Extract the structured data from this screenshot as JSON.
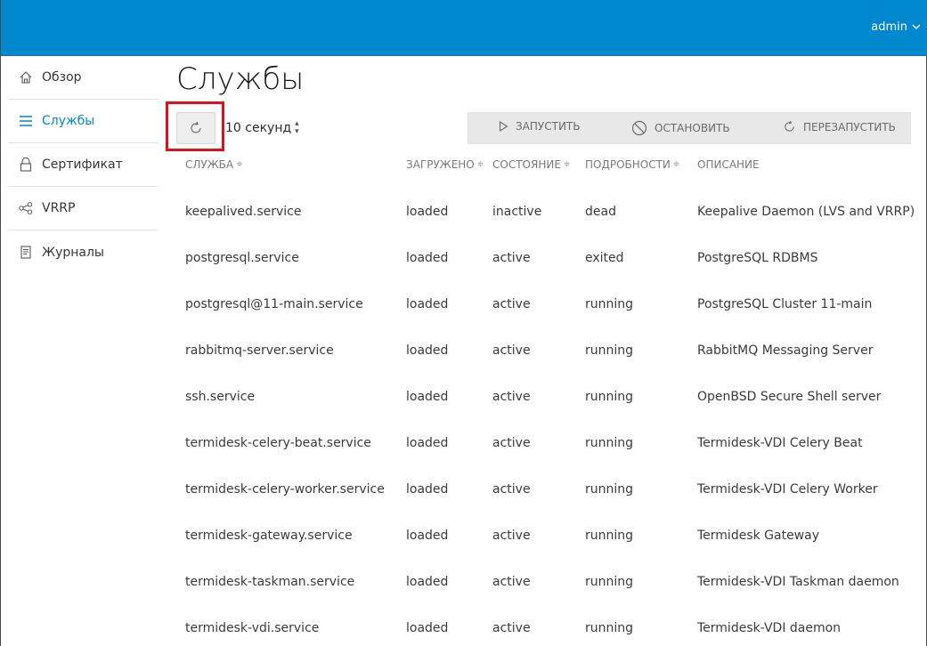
{
  "header": {
    "user": "admin"
  },
  "sidebar": {
    "items": [
      {
        "label": "Обзор",
        "icon": "home-icon"
      },
      {
        "label": "Службы",
        "icon": "list-icon",
        "active": true
      },
      {
        "label": "Сертификат",
        "icon": "lock-icon"
      },
      {
        "label": "VRRP",
        "icon": "share-icon"
      },
      {
        "label": "Журналы",
        "icon": "document-icon"
      }
    ]
  },
  "page": {
    "title": "Службы"
  },
  "toolbar": {
    "interval": "10 секунд",
    "start": "ЗАПУСТИТЬ",
    "stop": "ОСТАНОВИТЬ",
    "restart": "ПЕРЕЗАПУСТИТЬ"
  },
  "table": {
    "columns": [
      "СЛУЖБА",
      "ЗАГРУЖЕНО",
      "СОСТОЯНИЕ",
      "ПОДРОБНОСТИ",
      "ОПИСАНИЕ"
    ],
    "rows": [
      [
        "keepalived.service",
        "loaded",
        "inactive",
        "dead",
        "Keepalive Daemon (LVS and VRRP)"
      ],
      [
        "postgresql.service",
        "loaded",
        "active",
        "exited",
        "PostgreSQL RDBMS"
      ],
      [
        "postgresql@11-main.service",
        "loaded",
        "active",
        "running",
        "PostgreSQL Cluster 11-main"
      ],
      [
        "rabbitmq-server.service",
        "loaded",
        "active",
        "running",
        "RabbitMQ Messaging Server"
      ],
      [
        "ssh.service",
        "loaded",
        "active",
        "running",
        "OpenBSD Secure Shell server"
      ],
      [
        "termidesk-celery-beat.service",
        "loaded",
        "active",
        "running",
        "Termidesk-VDI Celery Beat"
      ],
      [
        "termidesk-celery-worker.service",
        "loaded",
        "active",
        "running",
        "Termidesk-VDI Celery Worker"
      ],
      [
        "termidesk-gateway.service",
        "loaded",
        "active",
        "running",
        "Termidesk Gateway"
      ],
      [
        "termidesk-taskman.service",
        "loaded",
        "active",
        "running",
        "Termidesk-VDI Taskman daemon"
      ],
      [
        "termidesk-vdi.service",
        "loaded",
        "active",
        "running",
        "Termidesk-VDI daemon"
      ]
    ]
  },
  "colors": {
    "accent": "#0088ce",
    "highlight": "#e0101a"
  }
}
